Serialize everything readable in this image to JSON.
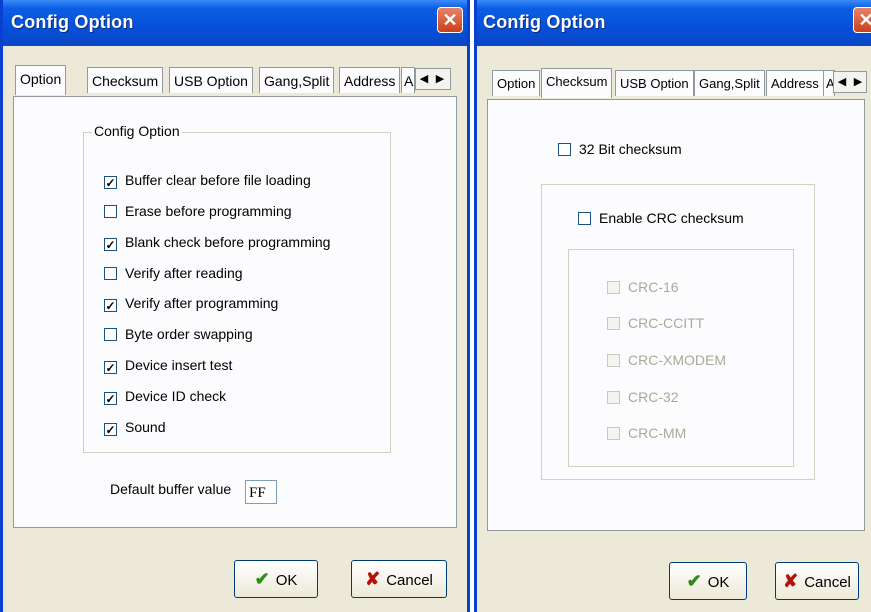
{
  "left": {
    "title": "Config Option",
    "tabs": [
      "Option",
      "Checksum",
      "USB Option",
      "Gang,Split",
      "Address",
      "A"
    ],
    "group_title": "Config Option",
    "options": [
      {
        "label": "Buffer clear before file loading",
        "checked": true
      },
      {
        "label": "Erase before programming",
        "checked": false
      },
      {
        "label": "Blank check before programming",
        "checked": true
      },
      {
        "label": "Verify after reading",
        "checked": false
      },
      {
        "label": "Verify after programming",
        "checked": true
      },
      {
        "label": "Byte order swapping",
        "checked": false
      },
      {
        "label": "Device insert test",
        "checked": true
      },
      {
        "label": "Device ID check",
        "checked": true
      },
      {
        "label": "Sound",
        "checked": true
      }
    ],
    "buffer_label": "Default buffer value",
    "buffer_value": "FF",
    "ok_label": "OK",
    "cancel_label": "Cancel"
  },
  "right": {
    "title": "Config Option",
    "tabs": [
      "Option",
      "Checksum",
      "USB Option",
      "Gang,Split",
      "Address",
      "A"
    ],
    "checksum32_label": "32 Bit checksum",
    "crc_enable_label": "Enable CRC checksum",
    "crc_options": [
      "CRC-16",
      "CRC-CCITT",
      "CRC-XMODEM",
      "CRC-32",
      "CRC-MM"
    ],
    "ok_label": "OK",
    "cancel_label": "Cancel"
  },
  "icons": {
    "close": "close-icon",
    "ok": "checkmark-icon",
    "cancel": "x-icon",
    "scroll_left": "arrow-left-icon",
    "scroll_right": "arrow-right-icon"
  },
  "colors": {
    "titlebar": "#0550d8",
    "dialog_bg": "#ece9d8",
    "close_button": "#c9411d"
  }
}
